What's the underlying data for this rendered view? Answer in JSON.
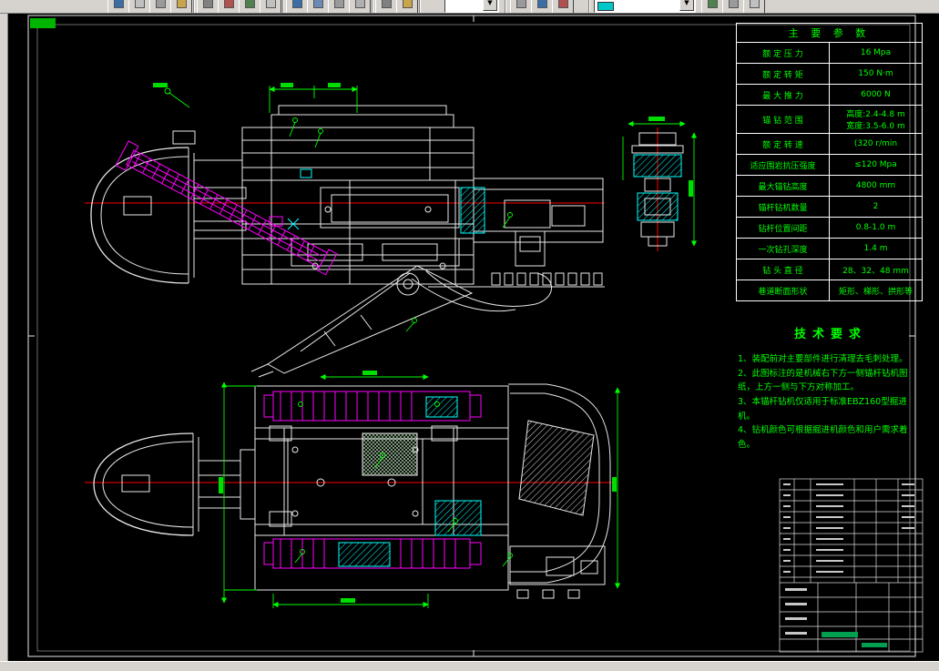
{
  "parameter_table": {
    "title": "主 要 参 数",
    "rows": [
      {
        "label": "额 定 压 力",
        "value": "16 Mpa"
      },
      {
        "label": "额 定 转 矩",
        "value": "150 N·m"
      },
      {
        "label": "最 大 推 力",
        "value": "6000 N"
      },
      {
        "label": "锚 钻 范 围",
        "value": "高度:2.4-4.8 m\n宽度:3.5-6.0 m"
      },
      {
        "label": "额 定 转 速",
        "value": "(320 r/min"
      },
      {
        "label": "适应围岩抗压强度",
        "value": "≤120 Mpa"
      },
      {
        "label": "最大锚钻高度",
        "value": "4800 mm"
      },
      {
        "label": "锚杆钻机数量",
        "value": "2"
      },
      {
        "label": "钻杆位置间距",
        "value": "0.8-1.0 m"
      },
      {
        "label": "一次钻孔深度",
        "value": "1.4 m"
      },
      {
        "label": "钻 头 直 径",
        "value": "28、32、48 mm"
      },
      {
        "label": "巷道断面形状",
        "value": "矩形、梯形、拱形等"
      }
    ]
  },
  "tech_requirements": {
    "title": "技术要求",
    "notes": [
      "1、装配前对主要部件进行清理去毛刺处理。",
      "2、此图标注的是机械右下方一侧锚杆钻机图纸，上方一侧与下方对称加工。",
      "3、本锚杆钻机仅适用于标准EBZ160型掘进机。",
      "4、钻机颜色可根据掘进机颜色和用户需求着色。"
    ]
  },
  "colors": {
    "canvas_bg": "#000000",
    "line": "#ffffff",
    "dimension_green": "#00ff00",
    "highlight_magenta": "#ff00ff",
    "highlight_cyan": "#00ffff",
    "centerline_red": "#ff0000"
  }
}
